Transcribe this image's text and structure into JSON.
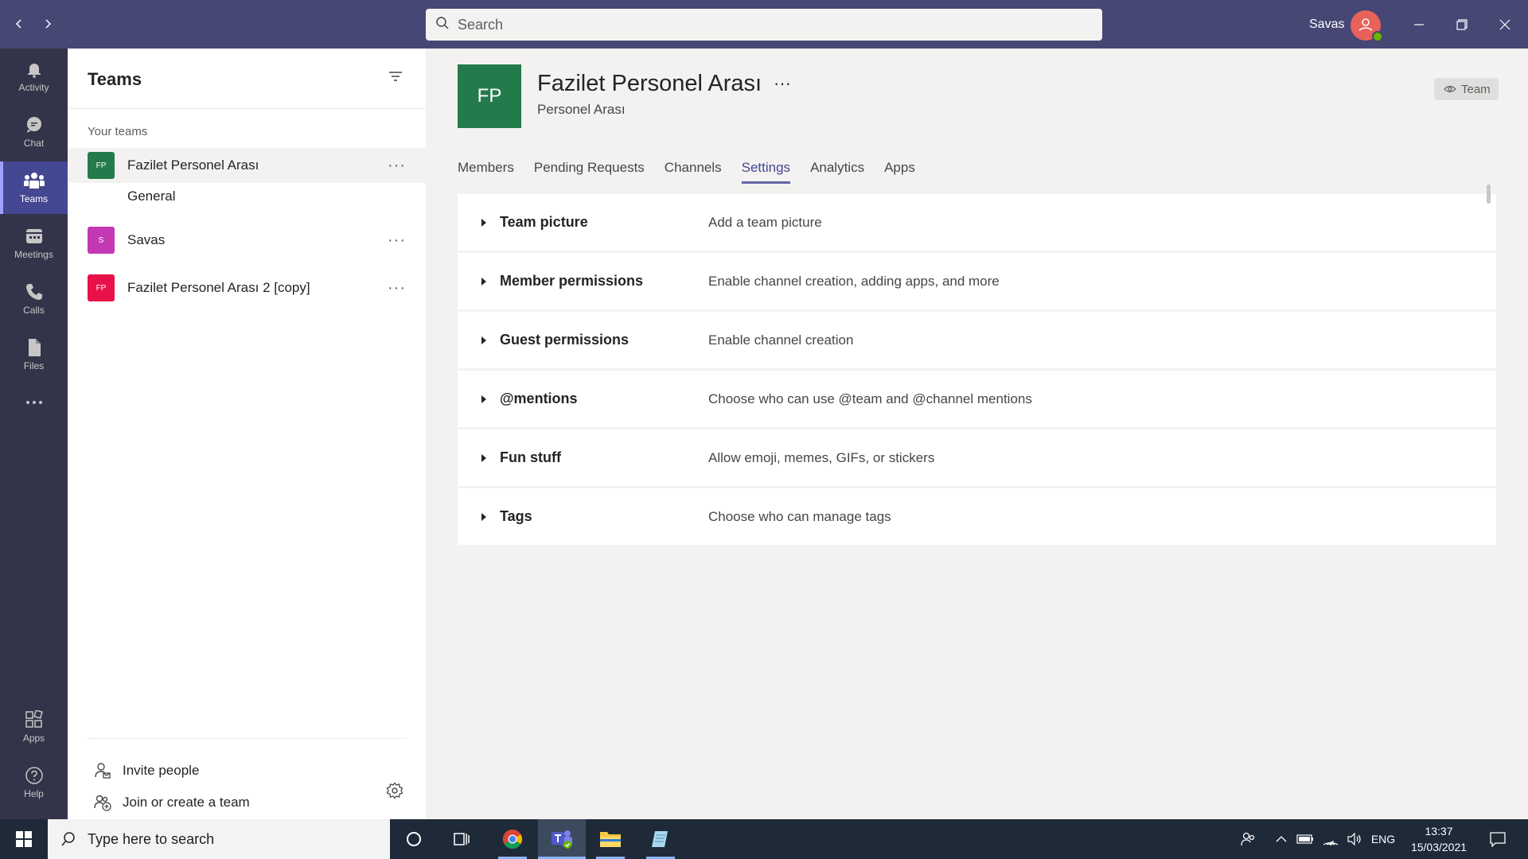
{
  "titlebar": {
    "search_placeholder": "Search",
    "user_name": "Savas",
    "back_label": "Back",
    "forward_label": "Forward"
  },
  "rail": {
    "items": [
      {
        "label": "Activity",
        "icon": "bell-icon"
      },
      {
        "label": "Chat",
        "icon": "chat-icon"
      },
      {
        "label": "Teams",
        "icon": "teams-icon",
        "active": true
      },
      {
        "label": "Meetings",
        "icon": "calendar-icon"
      },
      {
        "label": "Calls",
        "icon": "phone-icon"
      },
      {
        "label": "Files",
        "icon": "file-icon"
      },
      {
        "label": "",
        "icon": "more-icon"
      }
    ],
    "bottom_items": [
      {
        "label": "Apps",
        "icon": "apps-icon"
      },
      {
        "label": "Help",
        "icon": "help-icon"
      }
    ]
  },
  "left_panel": {
    "title": "Teams",
    "section_label": "Your teams",
    "teams": [
      {
        "badge": "FP",
        "name": "Fazilet Personel Arası",
        "color": "#237b4b",
        "selected": true
      },
      {
        "badge": "S",
        "name": "Savas",
        "color": "#c239b3"
      },
      {
        "badge": "FP",
        "name": "Fazilet Personel Arası 2 [copy]",
        "color": "#e81149"
      }
    ],
    "channel": "General",
    "more": "···",
    "footer": {
      "invite": "Invite people",
      "join_create": "Join or create a team"
    }
  },
  "main": {
    "team_avatar": "FP",
    "team_name": "Fazilet Personel Arası",
    "team_name_more": "···",
    "team_subtitle": "Personel Arası",
    "team_chip": "Team",
    "tabs": [
      "Members",
      "Pending Requests",
      "Channels",
      "Settings",
      "Analytics",
      "Apps"
    ],
    "active_tab": "Settings",
    "settings": [
      {
        "title": "Team picture",
        "desc": "Add a team picture"
      },
      {
        "title": "Member permissions",
        "desc": "Enable channel creation, adding apps, and more"
      },
      {
        "title": "Guest permissions",
        "desc": "Enable channel creation"
      },
      {
        "title": "@mentions",
        "desc": "Choose who can use @team and @channel mentions"
      },
      {
        "title": "Fun stuff",
        "desc": "Allow emoji, memes, GIFs, or stickers"
      },
      {
        "title": "Tags",
        "desc": "Choose who can manage tags"
      }
    ]
  },
  "taskbar": {
    "search_placeholder": "Type here to search",
    "language": "ENG",
    "time": "13:37",
    "date": "15/03/2021"
  },
  "colors": {
    "titlebar": "#464775",
    "rail": "#33344a",
    "accent": "#6264a7",
    "taskbar": "#1f2a38"
  }
}
